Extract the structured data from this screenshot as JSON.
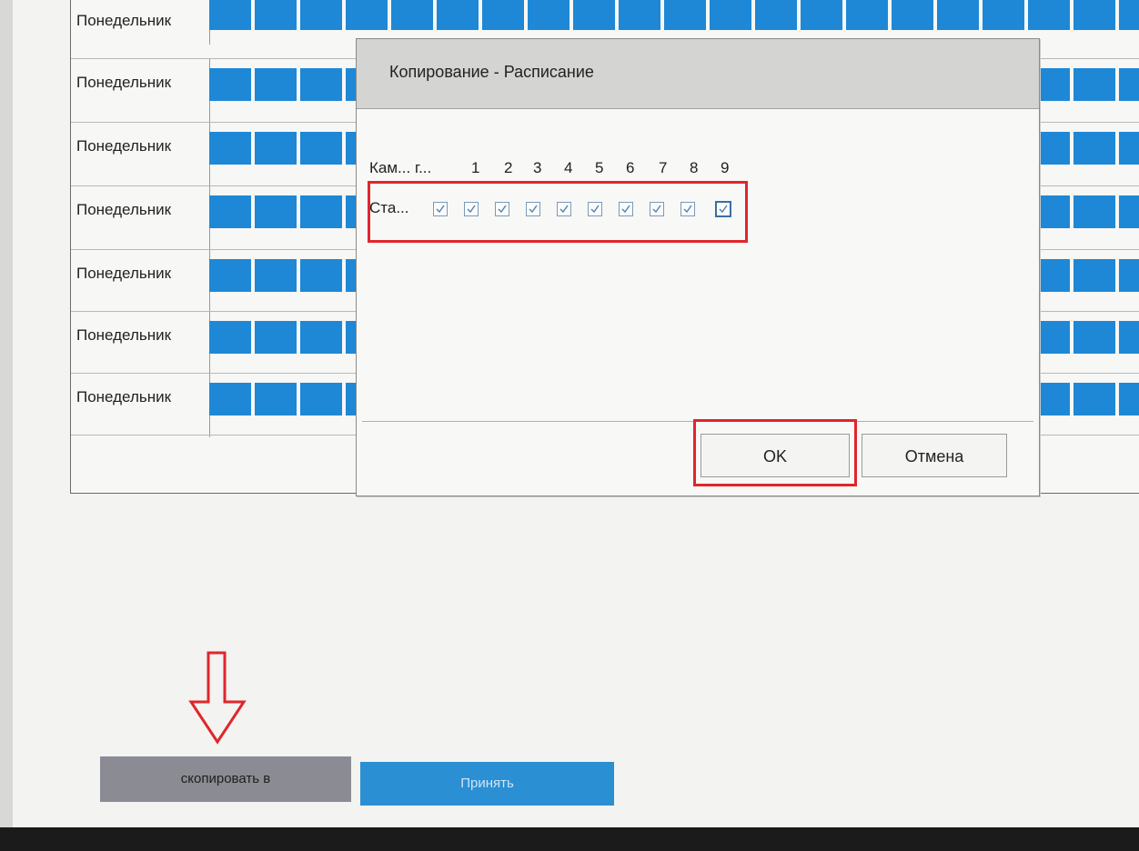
{
  "schedule": {
    "days": [
      "Понедельник",
      "Понедельник",
      "Понедельник",
      "Понедельник",
      "Понедельник",
      "Понедельник",
      "Понедельник"
    ],
    "active_color": "#1e88d6"
  },
  "dialog": {
    "title": "Копирование - Расписание",
    "camera_header": "Кам... г...",
    "camera_numbers": [
      "1",
      "2",
      "3",
      "4",
      "5",
      "6",
      "7",
      "8",
      "9"
    ],
    "row_label": "Ста...",
    "checkboxes_checked": [
      true,
      true,
      true,
      true,
      true,
      true,
      true,
      true,
      true,
      true
    ],
    "ok_label": "OK",
    "cancel_label": "Отмена",
    "highlight_color": "#e0262b"
  },
  "footer": {
    "copy_label": "скопировать в",
    "accept_label": "Принять"
  }
}
